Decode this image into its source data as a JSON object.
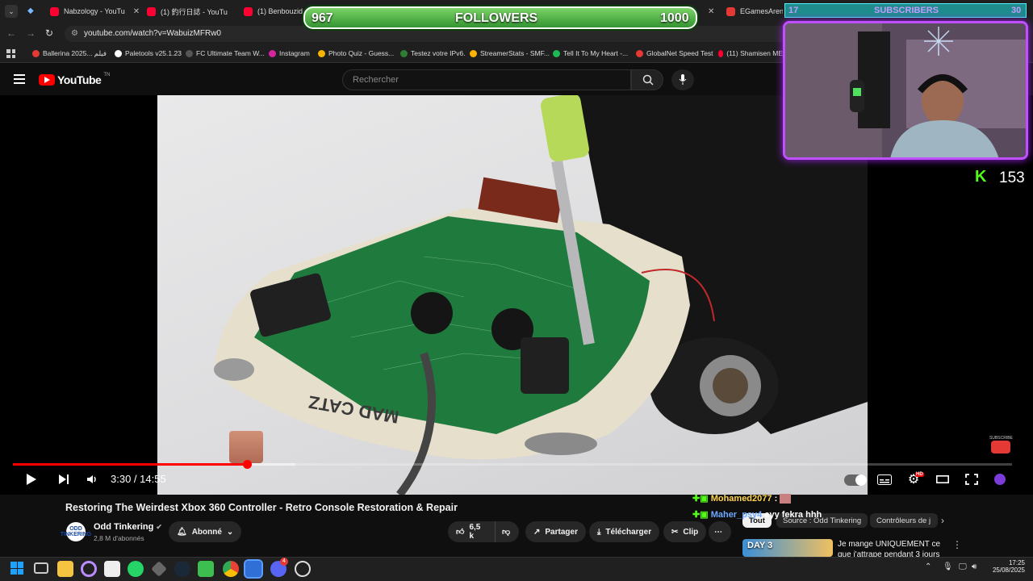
{
  "browser": {
    "tabs": [
      {
        "label": "Nabzology - YouTu"
      },
      {
        "label": "(1) 釣行日誌 - YouTu"
      },
      {
        "label": "(1) Benbouzid tv"
      },
      {
        "label": "EGamesArena"
      }
    ],
    "url": "youtube.com/watch?v=WabuizMFRw0",
    "bookmarks": [
      {
        "label": "Ballerina 2025... فيلم",
        "color": "#e53935"
      },
      {
        "label": "Paletools v25.1.23",
        "color": "#ffffff"
      },
      {
        "label": "FC Ultimate Team W...",
        "color": "#222222"
      },
      {
        "label": "Instagram",
        "color": "#d6249f"
      },
      {
        "label": "Photo Quiz - Guess...",
        "color": "#f5b400"
      },
      {
        "label": "Testez votre IPv6.",
        "color": "#2e7d32"
      },
      {
        "label": "StreamerStats - SMF...",
        "color": "#ffb300"
      },
      {
        "label": "Tell It To My Heart -...",
        "color": "#1db954"
      },
      {
        "label": "GlobalNet Speed Test",
        "color": "#e53935"
      },
      {
        "label": "(11) Shamisen ME",
        "color": "#ff0033"
      }
    ]
  },
  "youtube": {
    "logo_text": "YouTube",
    "logo_region": "TN",
    "search_placeholder": "Rechercher"
  },
  "player": {
    "current_time": "3:30",
    "duration": "14:55",
    "time_display": "3:30 / 14:55",
    "progress_fraction": 0.234,
    "buffered_fraction": 0.283,
    "hd_badge": "HD",
    "subscribe_watermark": "SUBSCRIBE"
  },
  "video": {
    "title": "Restoring The Weirdest Xbox 360 Controller - Retro Console Restoration & Repair",
    "channel": "Odd Tinkering",
    "channel_avatar_text": "ODD TINKERING",
    "subscribers": "2,8 M d'abonnés",
    "subscribed_label": "Abonné",
    "likes": "6,5 k",
    "share_label": "Partager",
    "download_label": "Télécharger",
    "clip_label": "Clip",
    "controller_brand": "MAD CATZ"
  },
  "recommendations": {
    "chips": [
      "Tout",
      "Source : Odd Tinkering",
      "Contrôleurs de j"
    ],
    "first": {
      "title": "Je mange UNIQUEMENT ce que j'attrape pendant 3 jours",
      "thumb_text": "DAY 3"
    }
  },
  "stream_overlay": {
    "followers_current": "967",
    "followers_label": "FOLLOWERS",
    "followers_goal": "1000",
    "followers_fraction": 0.967,
    "subscribers_current": "17",
    "subscribers_label": "SUBSCRIBERS",
    "subscribers_goal": "30",
    "kick_count": "153",
    "chat": [
      {
        "user": "Mohamed2077",
        "message": "",
        "user_color": "#ffd54f"
      },
      {
        "user": "Maher_psy4",
        "message": "eyy fekra hhh",
        "user_color": "#6ea8ff"
      }
    ]
  },
  "taskbar": {
    "time": "17:25",
    "date": "25/08/2025",
    "discord_badge": "4"
  }
}
